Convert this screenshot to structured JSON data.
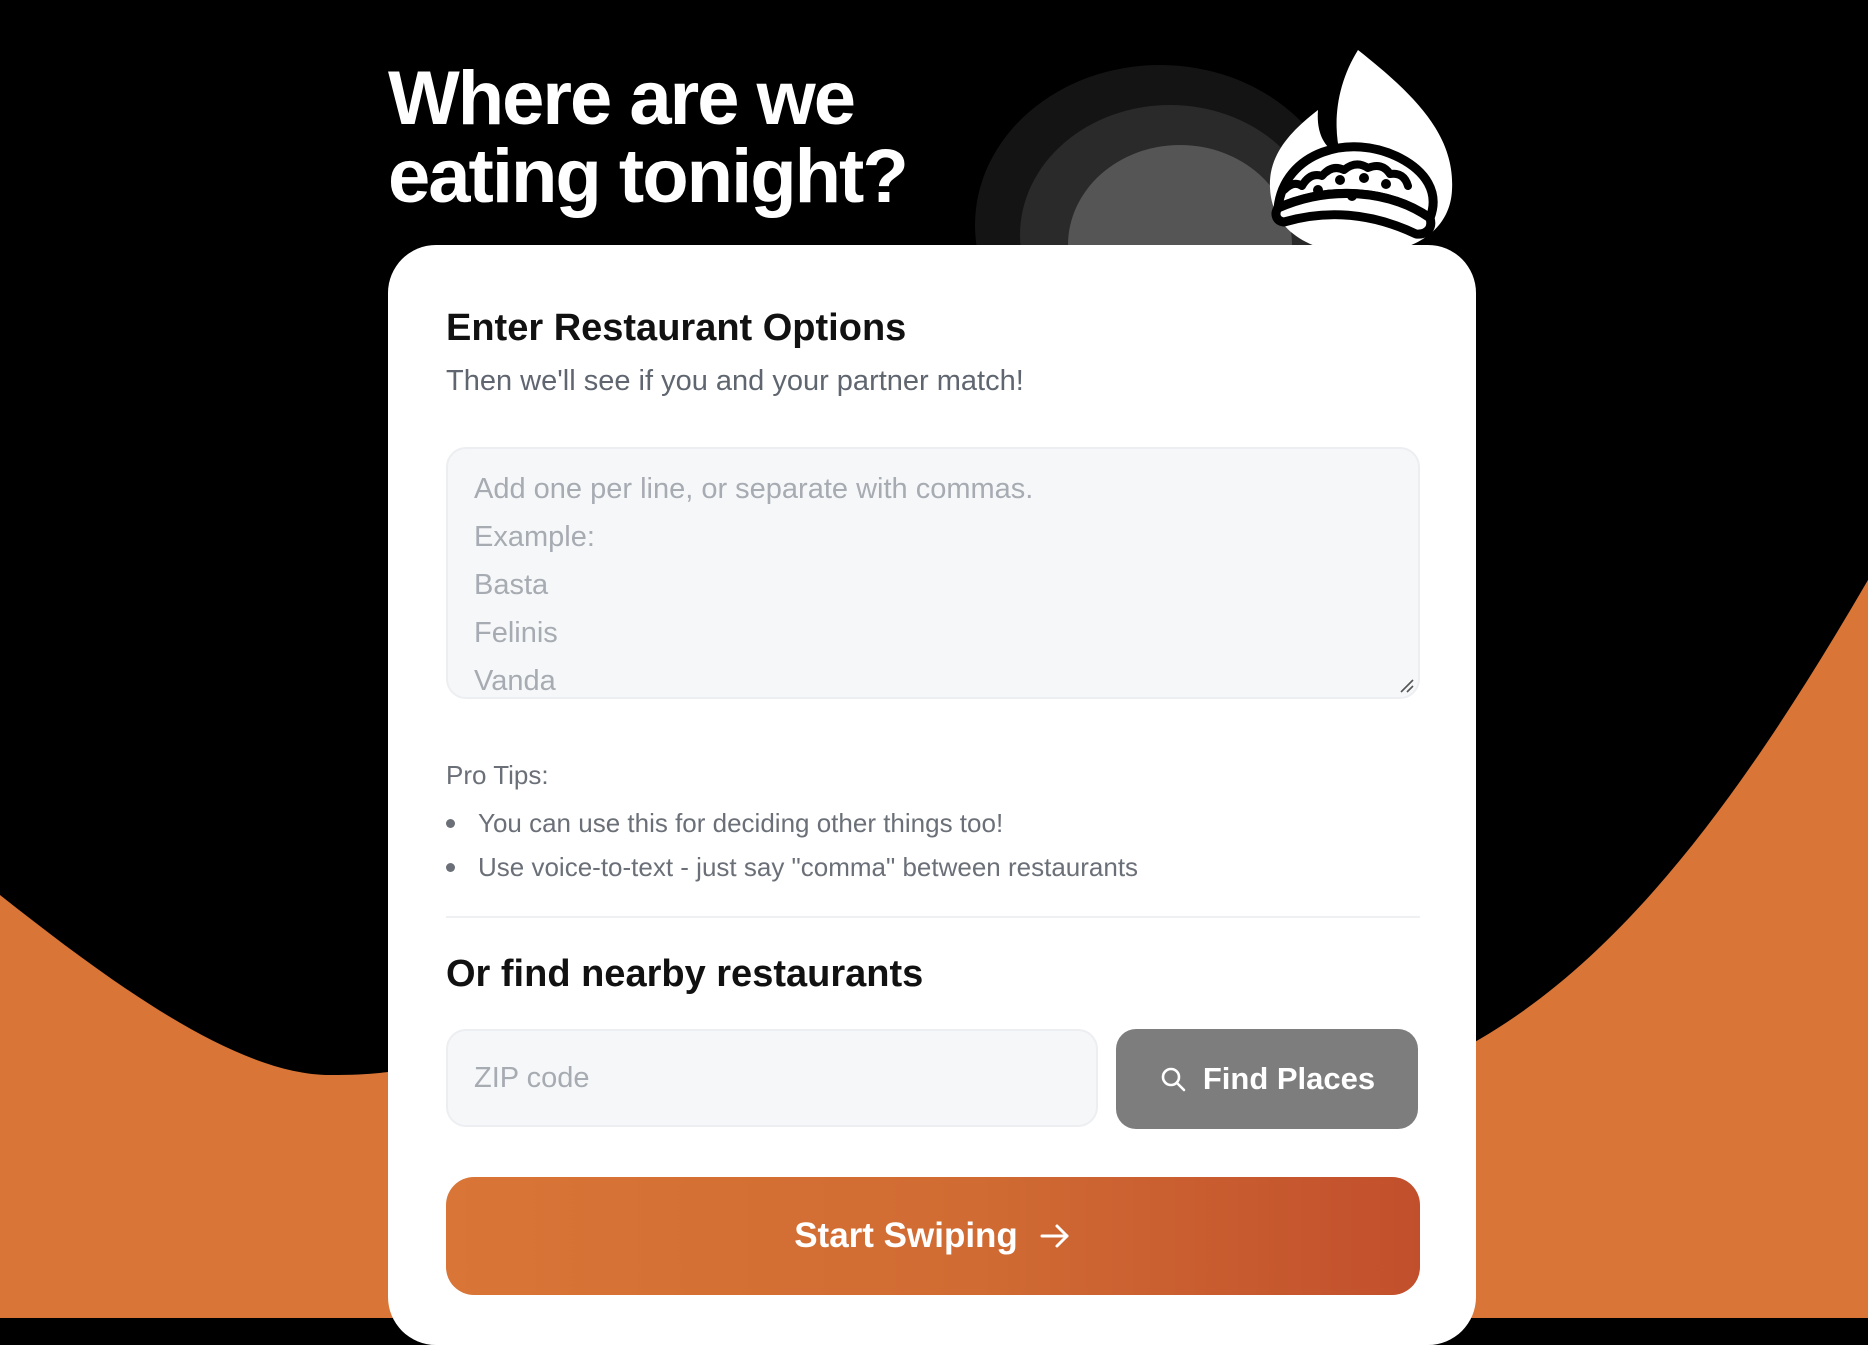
{
  "colors": {
    "background": "#000000",
    "accent_orange": "#d97536",
    "card": "#ffffff",
    "button_disabled": "#7d7d7d"
  },
  "header": {
    "title_line1": "Where are we",
    "title_line2": "eating tonight?",
    "mascot_icon": "flaming-taco-icon"
  },
  "form": {
    "title": "Enter Restaurant Options",
    "subtitle": "Then we'll see if you and your partner match!",
    "options_value": "",
    "options_placeholder": "Add one per line, or separate with commas.\nExample:\nBasta\nFelinis\nVanda",
    "tips_title": "Pro Tips:",
    "tips": [
      "You can use this for deciding other things too!",
      "Use voice-to-text - just say \"comma\" between restaurants"
    ]
  },
  "nearby": {
    "title": "Or find nearby restaurants",
    "zip_placeholder": "ZIP code",
    "zip_value": "",
    "find_button_label": "Find Places",
    "find_button_icon": "search-icon"
  },
  "start": {
    "label": "Start Swiping",
    "icon": "arrow-right-icon"
  }
}
